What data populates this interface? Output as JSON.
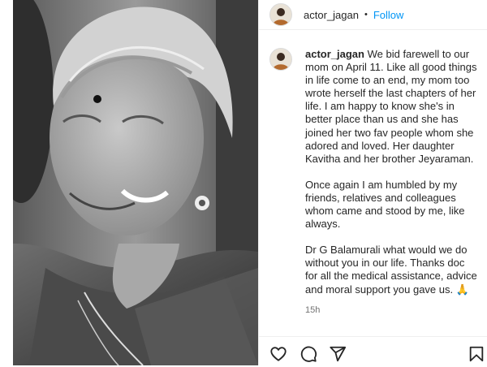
{
  "post": {
    "username": "actor_jagan",
    "dot": "•",
    "follow_label": "Follow"
  },
  "caption": {
    "username": "actor_jagan",
    "paragraph1": "We bid farewell to our mom on April 11. Like all good things in life come to an end, my mom too wrote herself the last chapters of her life. I am happy to know she's in better place than us and she has joined her two fav people whom she adored and loved. Her daughter Kavitha and her brother Jeyaraman.",
    "paragraph2": "Once again I am humbled by my friends, relatives and colleagues whom came and stood by me, like always.",
    "paragraph3": "Dr G Balamurali what would we do without you in our life. Thanks doc for all the medical assistance, advice and moral support you gave us.",
    "emoji": "🙏",
    "time": "15h"
  },
  "icons": {
    "like": "heart-icon",
    "comment": "comment-icon",
    "share": "paper-plane-icon",
    "save": "bookmark-icon"
  }
}
